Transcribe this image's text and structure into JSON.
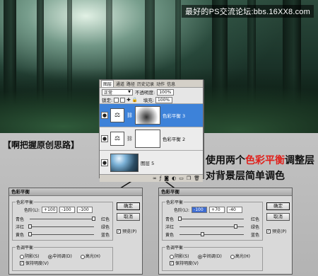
{
  "watermark": "最好的PS交流论坛:bbs.16XX8.com",
  "notes": {
    "left": "【啊把握原创思路】",
    "right_line1_pre": "使用两个",
    "right_line1_highlight": "色彩平衡",
    "right_line1_post": "调整层",
    "right_line2": "对背景层简单调色"
  },
  "layers_panel": {
    "tabs": [
      "图层",
      "通道",
      "路径",
      "历史记录",
      "动作",
      "信息"
    ],
    "active_tab": "图层",
    "blend_mode": "正常",
    "opacity_label": "不透明度:",
    "opacity_value": "100%",
    "lock_label": "锁定:",
    "fill_label": "填充:",
    "fill_value": "100%",
    "layers": [
      {
        "name": "色彩平衡 3",
        "active": true
      },
      {
        "name": "色彩平衡 2",
        "active": false
      },
      {
        "name": "图层 5",
        "active": false
      }
    ],
    "bottom_icons": [
      "link-icon",
      "fx-icon",
      "mask-icon",
      "adjustment-icon",
      "folder-icon",
      "new-layer-icon",
      "trash-icon"
    ]
  },
  "dialogs": [
    {
      "title": "色彩平衡",
      "group_label": "色彩平衡",
      "levels_label": "色阶(L):",
      "levels": [
        "+100",
        "-100",
        "-100"
      ],
      "highlight_first": false,
      "sliders": [
        {
          "left": "青色",
          "right": "红色",
          "value": 100
        },
        {
          "left": "洋红",
          "right": "绿色",
          "value": -100
        },
        {
          "left": "黄色",
          "right": "蓝色",
          "value": -100
        }
      ],
      "tone_group": "色调平衡",
      "tones": [
        "阴影(S)",
        "中间调(D)",
        "高光(H)"
      ],
      "tone_selected": 1,
      "keep_luminosity": "保持明度(V)",
      "ok": "确定",
      "cancel": "取消",
      "preview": "预览(P)"
    },
    {
      "title": "色彩平衡",
      "group_label": "色彩平衡",
      "levels_label": "色阶(L):",
      "levels": [
        "-100",
        "+70",
        "-40"
      ],
      "highlight_first": true,
      "sliders": [
        {
          "left": "青色",
          "right": "红色",
          "value": -100
        },
        {
          "left": "洋红",
          "right": "绿色",
          "value": 70
        },
        {
          "left": "黄色",
          "right": "蓝色",
          "value": -40
        }
      ],
      "tone_group": "色调平衡",
      "tones": [
        "阴影(S)",
        "中间调(D)",
        "高光(H)"
      ],
      "tone_selected": 1,
      "keep_luminosity": "保持明度(V)",
      "ok": "确定",
      "cancel": "取消",
      "preview": "预览(P)"
    }
  ]
}
